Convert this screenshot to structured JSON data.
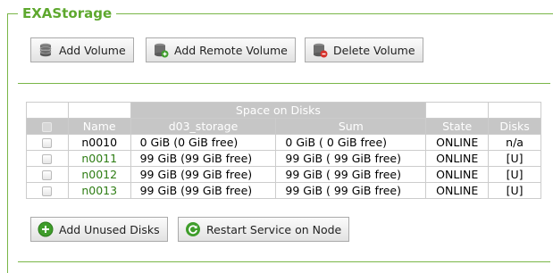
{
  "panel": {
    "title": "EXAStorage"
  },
  "toolbar": {
    "add_volume": "Add Volume",
    "add_remote_volume": "Add Remote Volume",
    "delete_volume": "Delete Volume"
  },
  "table": {
    "group_header": "Space on Disks",
    "columns": {
      "name": "Name",
      "storage": "d03_storage",
      "sum": "Sum",
      "state": "State",
      "disks": "Disks"
    },
    "rows": [
      {
        "name": "n0010",
        "storage": "0 GiB (0 GiB free)",
        "sum": "0 GiB ( 0 GiB free)",
        "state": "ONLINE",
        "disks": "n/a"
      },
      {
        "name": "n0011",
        "storage": "99 GiB (99 GiB free)",
        "sum": "99 GiB ( 99 GiB free)",
        "state": "ONLINE",
        "disks": "[U]"
      },
      {
        "name": "n0012",
        "storage": "99 GiB (99 GiB free)",
        "sum": "99 GiB ( 99 GiB free)",
        "state": "ONLINE",
        "disks": "[U]"
      },
      {
        "name": "n0013",
        "storage": "99 GiB (99 GiB free)",
        "sum": "99 GiB ( 99 GiB free)",
        "state": "ONLINE",
        "disks": "[U]"
      }
    ]
  },
  "actions": {
    "add_unused_disks": "Add Unused Disks",
    "restart_service": "Restart Service on Node"
  },
  "colors": {
    "accent": "#7ab648",
    "title": "#5ea82e",
    "header_bg": "#c6c6c6",
    "node_link": "#2e7d14"
  }
}
